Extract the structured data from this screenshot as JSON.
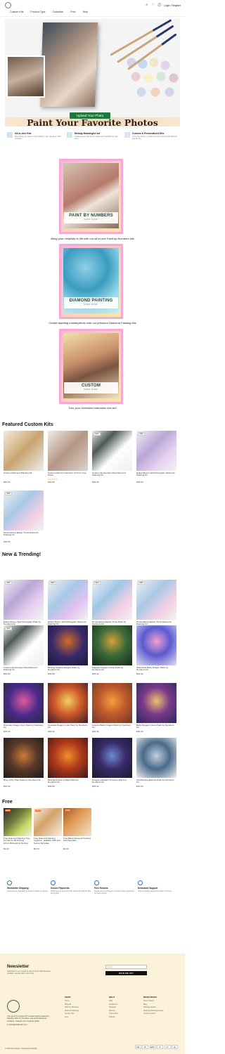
{
  "header": {
    "nav": [
      "Custom Kits",
      "Product Type",
      "Collection",
      "Free",
      "Help"
    ],
    "login": "Login / Register"
  },
  "hero": {
    "title": "Paint Your Favorite Photos",
    "button": "Upload Your Photo"
  },
  "features": [
    {
      "title": "All-in-One Kits",
      "desc": "Everything you need to start painting—kit, canvas & tools included.",
      "icon": "kit-icon"
    },
    {
      "title": "Melody Meaningful Art",
      "desc": "Create pieces that are as unique and heartfelt as your story.",
      "icon": "heart-art-icon"
    },
    {
      "title": "Custom & Personalized Kits",
      "desc": "Turn your photos or ideas into one-of-a-kind art tailored just for you.",
      "icon": "custom-icon"
    }
  ],
  "categories": [
    {
      "title": "PAINT BY NUMBERS",
      "cta": "SHOP NOW!",
      "caption": "Bring your creativity to life with our all-in-one Paint by Numbers kits"
    },
    {
      "title": "DIAMOND PAINTING",
      "cta": "SHOP NOW!",
      "caption": "Create dazzling masterpieces with our premium Diamond Painting kits"
    },
    {
      "title": "CUSTOM",
      "cta": "SHOP NOW!",
      "caption": "Turn your cherished memories into art!"
    }
  ],
  "featured": {
    "title": "Featured Custom Kits",
    "products": [
      {
        "name": "Custom Diamond Painting Kit",
        "old": "",
        "price": "$49.50",
        "badge": "",
        "stars": ""
      },
      {
        "name": "Custom Paint by Numbers Kit from Your Photo",
        "old": "",
        "price": "$34.99",
        "badge": "",
        "stars": "★★★★★"
      },
      {
        "name": "Custom Anniversary Map Diamond Painting Kit",
        "old": "",
        "price": "$59.90",
        "badge": "NEW",
        "stars": ""
      },
      {
        "name": "Easter Bunny Split Monogram Diamond Painting Kit",
        "old": "",
        "price": "$39.50",
        "badge": "NEW",
        "stars": ""
      },
      {
        "name": "Personalized Easter Truck Diamond Painting Kit",
        "old": "",
        "price": "$39.50",
        "badge": "NEW",
        "stars": ""
      }
    ]
  },
  "trending": {
    "title": "New & Trending!",
    "products": [
      {
        "name": "Easter Bunny Split Monogram Paint by Numbers Kit",
        "old": "$",
        "price": "$34.50",
        "badge": "NEW"
      },
      {
        "name": "Easter Bunny Split Monogram Diamond Painting Kit",
        "old": "",
        "price": "$39.50",
        "badge": "NEW"
      },
      {
        "name": "Personalized Easter Truck Paint by Numbers Kit",
        "old": "$",
        "price": "$34.50",
        "badge": "NEW"
      },
      {
        "name": "Personalized Easter Truck Diamond Painting Kit",
        "old": "",
        "price": "$39.50",
        "badge": "NEW"
      },
      {
        "name": "Custom Anniversary Map Diamond Painting Kit",
        "old": "",
        "price": "$59.90",
        "badge": "NEW"
      },
      {
        "name": "Blazing Shadow Dragon Paint by Numbers Kit",
        "old": "",
        "price": "$35.99",
        "badge": ""
      },
      {
        "name": "Majestic Dragon's Roar Paint by Numbers Kit",
        "old": "",
        "price": "$35.99",
        "badge": ""
      },
      {
        "name": "Whimsical Baby Dragon Paint by Numbers Kit",
        "old": "",
        "price": "$33.99",
        "badge": ""
      },
      {
        "name": "Prismatic Dragon Fury Paint by Numbers Kit",
        "old": "",
        "price": "$35.99",
        "badge": ""
      },
      {
        "name": "Celestial Dragon's Lair Paint by Numbers Kit",
        "old": "",
        "price": "$35.99",
        "badge": ""
      },
      {
        "name": "Autumn Baby Dragon Paint by Numbers Kit",
        "old": "",
        "price": "$35.99",
        "badge": ""
      },
      {
        "name": "Baby Dragon's Glow Paint by Numbers Kit",
        "old": "",
        "price": "$35.99",
        "badge": ""
      },
      {
        "name": "Rise of the Titan Paint by Numbers Kit",
        "old": "",
        "price": "$35.99",
        "badge": ""
      },
      {
        "name": "Blazing Dragon's Flight Paint by Numbers Kit",
        "old": "",
        "price": "$35.99",
        "badge": ""
      },
      {
        "name": "Dragon's Radiant Treasure Paint by Numbers Kit",
        "old": "",
        "price": "$35.99",
        "badge": ""
      },
      {
        "name": "Gold Eyeing Eternity Paint by Numbers Kit",
        "old": "",
        "price": "$35.99",
        "badge": ""
      }
    ]
  },
  "free": {
    "title": "Free",
    "products": [
      {
        "name": "Free Diamond Painting Tray Kit File for 3D Printing - 10mm Rhinestone Sorting",
        "price": "$0.00",
        "badge": "FREE"
      },
      {
        "name": "Free Diamond Painting Logbook - Editable PDF and Canva Template",
        "price": "$0.00",
        "badge": "FREE"
      },
      {
        "name": "Free Blank Diamond Painting Grid Template",
        "price": "$0.00",
        "badge": "FREE"
      }
    ]
  },
  "services": [
    {
      "title": "Worldwide Shipping",
      "desc": "Choose Free Standard or Express delivery options."
    },
    {
      "title": "Secure Payments",
      "desc": "100% secure payment with advanced 256-bit SSL encryption."
    },
    {
      "title": "Free Returns",
      "desc": "Hassle-free exchanges or money-back guarantee for store orders."
    },
    {
      "title": "Dedicated Support",
      "desc": "FAQ & friendly assistance within 24 hours."
    }
  ],
  "footer": {
    "nl_title": "Newsletter",
    "nl_desc": "Subscribe to our emails to stay in touch with the latest updates, special offers, and more.",
    "nl_placeholder": "Email",
    "nl_button": "SIGN ME UP!",
    "brand_desc": "Your go-to for custom DIY art kits! Explore Diamond Painting, Paint by Numbers, and personalized art creations. Unleash your creativity today!",
    "email": "hello@artistbudin.com",
    "cols": [
      {
        "title": "SHOP",
        "links": [
          "Home",
          "Shop All",
          "Paint by Numbers",
          "Diamond Painting",
          "Custom Kits",
          "Free"
        ]
      },
      {
        "title": "HELP",
        "links": [
          "FAQ",
          "Contact Us",
          "Shipping",
          "Returns",
          "Track Order",
          "Policies"
        ]
      },
      {
        "title": "RESOURCES",
        "links": [
          "How It Works",
          "Blog",
          "Painting Guides",
          "Diamond Painting Guides",
          "Custom Guides"
        ]
      }
    ],
    "copyright": "© 2025 Artist Budin · Powered by Shopify",
    "payments": [
      "VISA",
      "MC",
      "AMEX",
      "PP",
      "GP",
      "AP"
    ]
  }
}
